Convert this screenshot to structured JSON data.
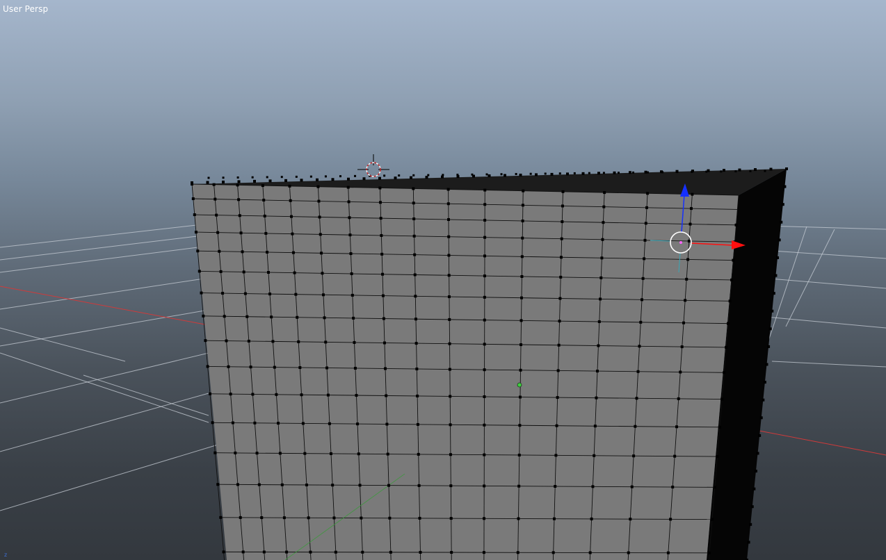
{
  "viewport": {
    "label": "User Persp",
    "corner_axis_label": "z",
    "colors": {
      "background_top": "#a5b6cc",
      "background_bottom": "#33383e",
      "grid_line": "#c8ced6",
      "x_axis": "#d03a3a",
      "y_axis": "#3c9a3c",
      "mesh_face": "#7a7a7a",
      "mesh_side": "#050505",
      "mesh_vertex": "#000000",
      "gizmo_x": "#ff1010",
      "gizmo_z": "#1530ff",
      "gizmo_ring": "#ffffff",
      "object_origin": "#3fcf3f",
      "cursor_3d": "#cc2222"
    }
  },
  "mesh": {
    "object_type": "cube",
    "subdivisions_visible": 16,
    "selection_mode": "vertex"
  },
  "gizmo": {
    "type": "translate",
    "axes": [
      "x",
      "z"
    ]
  }
}
